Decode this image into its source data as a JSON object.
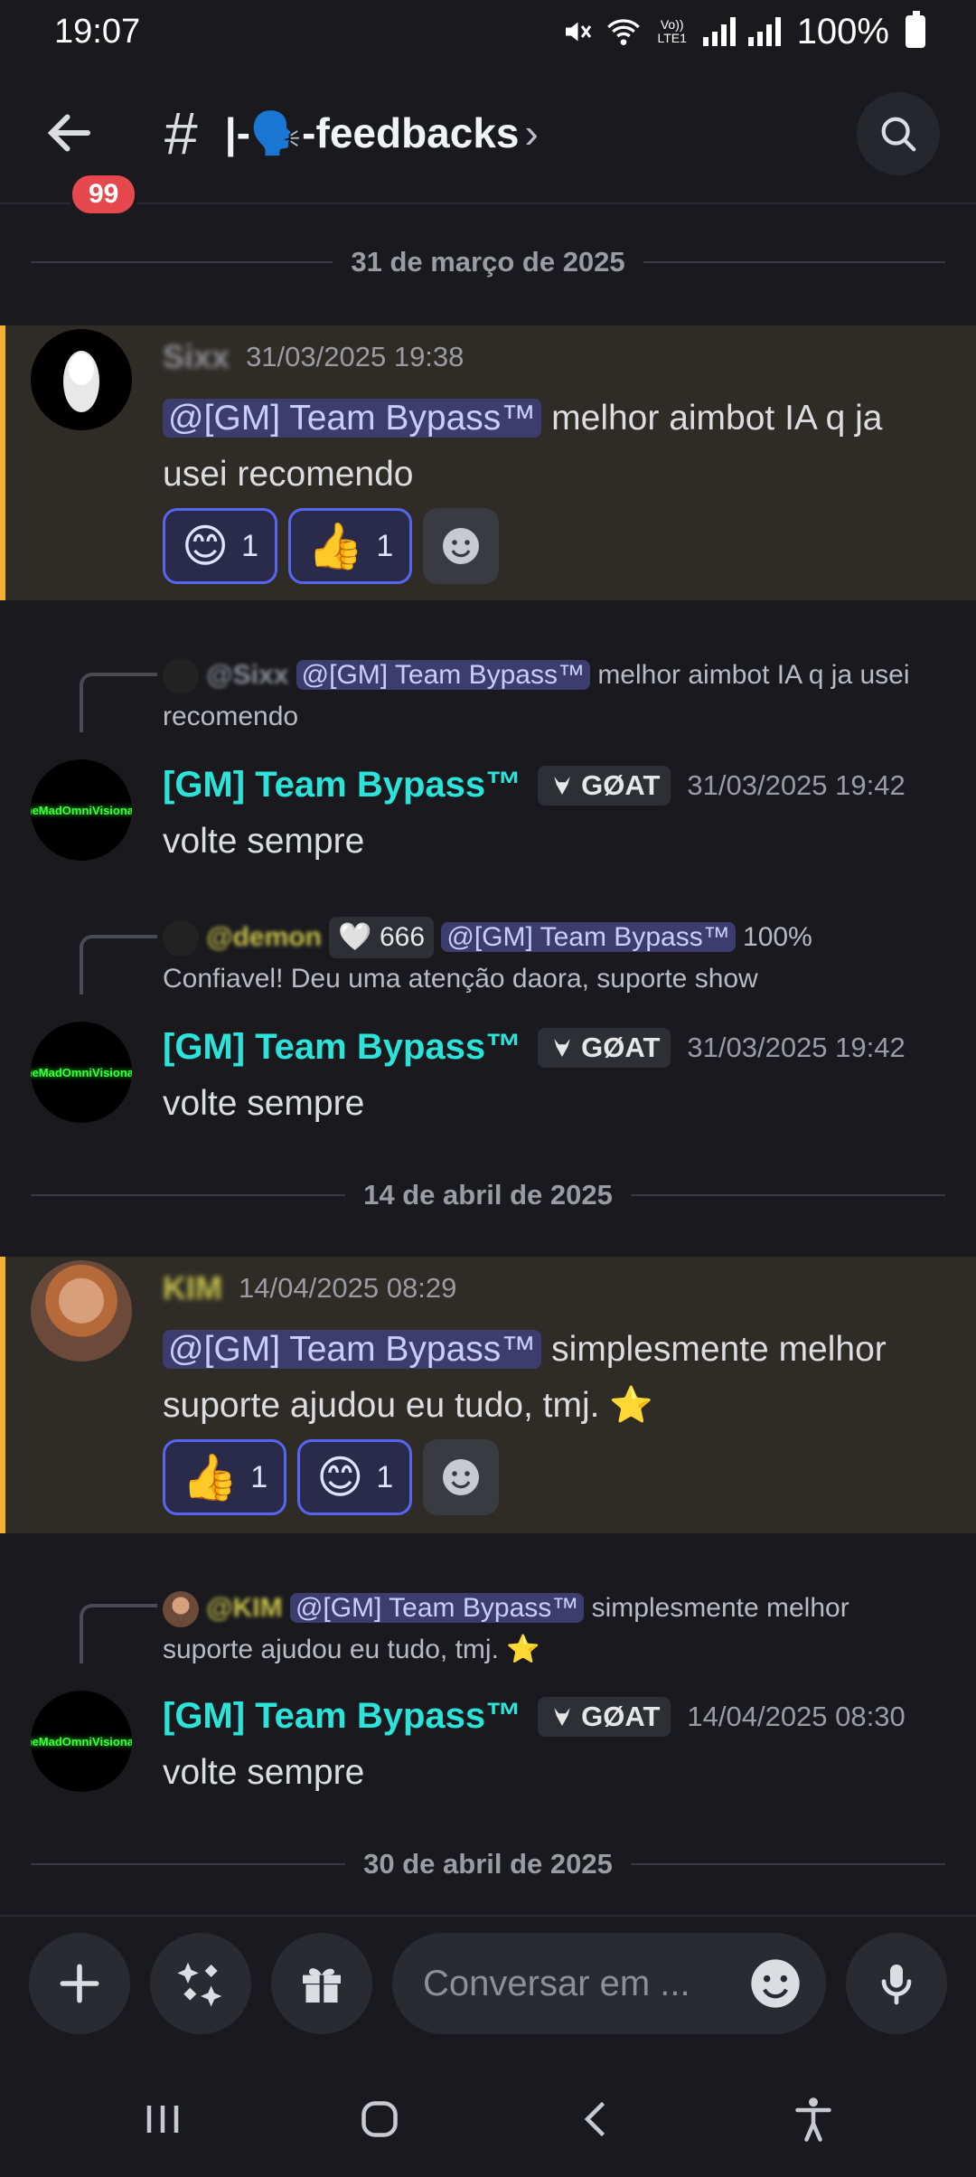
{
  "status_bar": {
    "time": "19:07",
    "volte": "Vo)) LTE1",
    "battery": "100%"
  },
  "header": {
    "unread_badge": "99",
    "hash": "#",
    "channel_name": "|-🗣️-feedbacks",
    "chevron": "›"
  },
  "dates": [
    "31 de março de 2025",
    "14 de abril de 2025",
    "30 de abril de 2025"
  ],
  "messages": [
    {
      "username": "Sixx",
      "timestamp": "31/03/2025 19:38",
      "mention": "@[GM] Team Bypass™",
      "text_line1": " melhor aimbot IA q ja",
      "text_line2": "usei recomendo",
      "reactions": [
        {
          "emoji": "😊",
          "count": "1"
        },
        {
          "emoji": "👍",
          "count": "1"
        }
      ]
    },
    {
      "reply_username": "@Sixx",
      "reply_mention": "@[GM] Team Bypass™",
      "reply_text_1": " melhor aimbot IA q ja usei",
      "reply_text_2": "recomendo",
      "bot_name": "[GM] Team Bypass™",
      "goat": "GØAT",
      "timestamp": "31/03/2025 19:42",
      "text": "volte sempre"
    },
    {
      "reply_username": "@demon",
      "reply_badge": "🤍 666",
      "reply_mention": "@[GM] Team Bypass™",
      "reply_text_1": " 100%",
      "reply_text_2": "Confiavel! Deu uma atenção daora, suporte show",
      "bot_name": "[GM] Team Bypass™",
      "goat": "GØAT",
      "timestamp": "31/03/2025 19:42",
      "text": "volte sempre"
    },
    {
      "username": "KIM",
      "timestamp": "14/04/2025 08:29",
      "mention": "@[GM] Team Bypass™",
      "text_line1": " simplesmente melhor",
      "text_line2": "suporte ajudou eu tudo, tmj. ⭐",
      "reactions": [
        {
          "emoji": "👍",
          "count": "1"
        },
        {
          "emoji": "😊",
          "count": "1"
        }
      ]
    },
    {
      "reply_username": "@KIM",
      "reply_mention": "@[GM] Team Bypass™",
      "reply_text_1": " simplesmente melhor",
      "reply_text_2": "suporte ajudou eu tudo, tmj. ⭐",
      "bot_name": "[GM] Team Bypass™",
      "goat": "GØAT",
      "timestamp": "14/04/2025 08:30",
      "text": "volte sempre"
    }
  ],
  "avatar_text": "TheMadOmniVisionary",
  "composer": {
    "placeholder": "Conversar em ..."
  },
  "colors": {
    "accent": "#5865f2",
    "bot_name": "#2be3d9",
    "highlight_border": "#f0b232",
    "badge": "#e5484d"
  }
}
